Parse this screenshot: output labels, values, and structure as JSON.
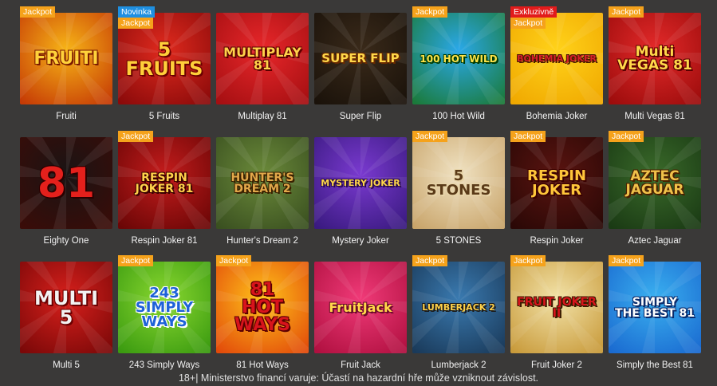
{
  "games": [
    {
      "name": "Fruiti",
      "badges": [
        "Jackpot"
      ],
      "art": "FRUITI",
      "bg": [
        "#f7b417",
        "#c53a05"
      ],
      "fg": "#ffd23a",
      "stroke": "#7a1a00",
      "size": 22
    },
    {
      "name": "5 Fruits",
      "badges": [
        "Novinka",
        "Jackpot"
      ],
      "art": "5\nFRUITS",
      "bg": [
        "#e02a1e",
        "#8a0a0a"
      ],
      "fg": "#ffcf3a",
      "stroke": "#6a0000",
      "size": 24
    },
    {
      "name": "Multiplay 81",
      "badges": [],
      "art": "MULTIPLAY\n81",
      "bg": [
        "#e8272a",
        "#a50f12"
      ],
      "fg": "#ffd24a",
      "stroke": "#5a0000",
      "size": 16
    },
    {
      "name": "Super Flip",
      "badges": [],
      "art": "SUPER FLIP",
      "bg": [
        "#3a2a1a",
        "#1a120a"
      ],
      "fg": "#ffd84a",
      "stroke": "#6a2a00",
      "size": 15
    },
    {
      "name": "100 Hot Wild",
      "badges": [
        "Jackpot"
      ],
      "art": "100 HOT WILD",
      "bg": [
        "#2aa8e8",
        "#1b7a3a"
      ],
      "fg": "#ffe34a",
      "stroke": "#003a00",
      "size": 12
    },
    {
      "name": "Bohemia Joker",
      "badges": [
        "Exkluzivně",
        "Jackpot"
      ],
      "art": "BOHEMIA JOKER",
      "bg": [
        "#ffd21a",
        "#f0a800"
      ],
      "fg": "#d6202a",
      "stroke": "#4a1a00",
      "size": 11
    },
    {
      "name": "Multi Vegas 81",
      "badges": [
        "Jackpot"
      ],
      "art": "Multi\nVEGAS 81",
      "bg": [
        "#e42a2a",
        "#9c0c0c"
      ],
      "fg": "#ffd84a",
      "stroke": "#5a0000",
      "size": 17
    },
    {
      "name": "Eighty One",
      "badges": [],
      "art": "81",
      "bg": [
        "#1a1414",
        "#3a0c08"
      ],
      "fg": "#e4201c",
      "stroke": "#2a0000",
      "size": 52
    },
    {
      "name": "Respin Joker 81",
      "badges": [
        "Jackpot"
      ],
      "art": "RESPIN\nJOKER 81",
      "bg": [
        "#c41c1c",
        "#6a0606"
      ],
      "fg": "#ffd24a",
      "stroke": "#3a0000",
      "size": 14
    },
    {
      "name": "Hunter's Dream 2",
      "badges": [],
      "art": "HUNTER'S\nDREAM 2",
      "bg": [
        "#6b8a3a",
        "#3a5020"
      ],
      "fg": "#e2a84a",
      "stroke": "#3a2000",
      "size": 14
    },
    {
      "name": "Mystery Joker",
      "badges": [],
      "art": "MYSTERY JOKER",
      "bg": [
        "#7a3ad0",
        "#3a1a80"
      ],
      "fg": "#ffd84a",
      "stroke": "#2a0a4a",
      "size": 11
    },
    {
      "name": "5 STONES",
      "badges": [
        "Jackpot"
      ],
      "art": "5\nSTONES",
      "bg": [
        "#f0e2c2",
        "#c8a46a"
      ],
      "fg": "#5a3a18",
      "stroke": "#e8d4a8",
      "size": 18
    },
    {
      "name": "Respin Joker",
      "badges": [
        "Jackpot"
      ],
      "art": "RESPIN\nJOKER",
      "bg": [
        "#5a1410",
        "#2a0806"
      ],
      "fg": "#ffc63a",
      "stroke": "#3a0000",
      "size": 18
    },
    {
      "name": "Aztec Jaguar",
      "badges": [
        "Jackpot"
      ],
      "art": "AZTEC\nJAGUAR",
      "bg": [
        "#3a6a2a",
        "#1a3a14"
      ],
      "fg": "#f0c24a",
      "stroke": "#4a2000",
      "size": 17
    },
    {
      "name": "Multi 5",
      "badges": [],
      "art": "MULTI\n5",
      "bg": [
        "#d8201c",
        "#7a0808"
      ],
      "fg": "#f2f2f2",
      "stroke": "#6a0000",
      "size": 24
    },
    {
      "name": "243 Simply Ways",
      "badges": [
        "Jackpot"
      ],
      "art": "243\nSIMPLY\nWAYS",
      "bg": [
        "#8ad830",
        "#3a9a10"
      ],
      "fg": "#1e62d8",
      "stroke": "#ffffff",
      "size": 18
    },
    {
      "name": "81 Hot Ways",
      "badges": [
        "Jackpot"
      ],
      "art": "81\nHOT WAYS",
      "bg": [
        "#ffc21a",
        "#e24a0a"
      ],
      "fg": "#d8141c",
      "stroke": "#5a0000",
      "size": 22
    },
    {
      "name": "Fruit Jack",
      "badges": [],
      "art": "FruitJack",
      "bg": [
        "#f03a78",
        "#b01040"
      ],
      "fg": "#ffd84a",
      "stroke": "#6a0a2a",
      "size": 16
    },
    {
      "name": "Lumberjack 2",
      "badges": [
        "Jackpot"
      ],
      "art": "LUMBERJACK 2",
      "bg": [
        "#3a7ab0",
        "#1a3a5a"
      ],
      "fg": "#ffd24a",
      "stroke": "#1a1a1a",
      "size": 11
    },
    {
      "name": "Fruit Joker 2",
      "badges": [
        "Jackpot"
      ],
      "art": "FRUIT JOKER\nII",
      "bg": [
        "#f2e2a8",
        "#c89a3a"
      ],
      "fg": "#d8141c",
      "stroke": "#3a1a00",
      "size": 14
    },
    {
      "name": "Simply the Best 81",
      "badges": [
        "Jackpot"
      ],
      "art": "SIMPLY\nTHE BEST 81",
      "bg": [
        "#3ab0f0",
        "#1a6ad0"
      ],
      "fg": "#ffffff",
      "stroke": "#0a2a6a",
      "size": 14
    }
  ],
  "footer": {
    "text": "18+| Ministerstvo financí varuje: Účastí na hazardní hře může vzniknout závislost."
  },
  "colors": {
    "background": "#3a3938",
    "jackpot_badge": "#f5a21b",
    "novinka_badge": "#1f8fe0",
    "exkluzivne_badge": "#e21b1b"
  }
}
